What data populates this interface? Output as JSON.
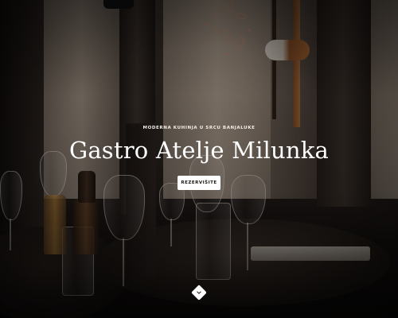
{
  "hero": {
    "tagline": "MODERNA KUHINJA U SRCU BANJALUKE",
    "title": "Gastro Atelje Milunka",
    "cta_label": "REZERVIŠITE",
    "scroll_icon": "chevron-down-icon"
  },
  "colors": {
    "title": "#ffffff",
    "cta_background": "#ffffff",
    "cta_text": "#1a1613"
  }
}
